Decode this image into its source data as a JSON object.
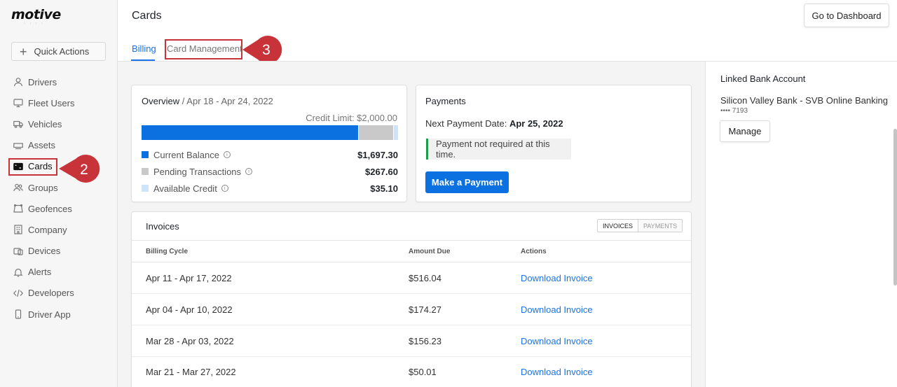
{
  "app": {
    "logo": "motive"
  },
  "sidebar": {
    "quick_actions": "Quick Actions",
    "items": [
      {
        "label": "Drivers",
        "icon": "user-icon"
      },
      {
        "label": "Fleet Users",
        "icon": "monitor-icon"
      },
      {
        "label": "Vehicles",
        "icon": "truck-icon"
      },
      {
        "label": "Assets",
        "icon": "trailer-icon"
      },
      {
        "label": "Cards",
        "icon": "card-icon"
      },
      {
        "label": "Groups",
        "icon": "group-icon"
      },
      {
        "label": "Geofences",
        "icon": "geofence-icon"
      },
      {
        "label": "Company",
        "icon": "building-icon"
      },
      {
        "label": "Devices",
        "icon": "device-icon"
      },
      {
        "label": "Alerts",
        "icon": "bell-icon"
      },
      {
        "label": "Developers",
        "icon": "code-icon"
      },
      {
        "label": "Driver App",
        "icon": "phone-icon"
      }
    ],
    "active": "Cards"
  },
  "callouts": {
    "step2": "2",
    "step3": "3",
    "color": "#c8333a"
  },
  "header": {
    "title": "Cards",
    "goto_dashboard": "Go to Dashboard",
    "tabs": [
      {
        "label": "Billing",
        "active": true
      },
      {
        "label": "Card Management",
        "active": false
      }
    ]
  },
  "overview": {
    "title": "Overview",
    "date_range": " / Apr 18 - Apr 24, 2022",
    "credit_limit": "Credit Limit: $2,000.00",
    "bar_fractions": {
      "current": 0.8487,
      "pending": 0.1338,
      "available": 0.0176
    },
    "legend": [
      {
        "label": "Current Balance",
        "value": "$1,697.30",
        "color": "#0b70e0"
      },
      {
        "label": "Pending Transactions",
        "value": "$267.60",
        "color": "#c9c9c9"
      },
      {
        "label": "Available Credit",
        "value": "$35.10",
        "color": "#cfe4f8"
      }
    ]
  },
  "payments": {
    "title": "Payments",
    "next_label": "Next Payment Date: ",
    "next_date": "Apr 25, 2022",
    "notice": "Payment not required at this time.",
    "make_payment": "Make a Payment"
  },
  "invoices": {
    "title": "Invoices",
    "toggle": [
      "INVOICES",
      "PAYMENTS"
    ],
    "columns": [
      "Billing Cycle",
      "Amount Due",
      "Actions"
    ],
    "rows": [
      {
        "cycle": "Apr 11 - Apr 17, 2022",
        "amount": "$516.04",
        "action": "Download Invoice"
      },
      {
        "cycle": "Apr 04 - Apr 10, 2022",
        "amount": "$174.27",
        "action": "Download Invoice"
      },
      {
        "cycle": "Mar 28 - Apr 03, 2022",
        "amount": "$156.23",
        "action": "Download Invoice"
      },
      {
        "cycle": "Mar 21 - Mar 27, 2022",
        "amount": "$50.01",
        "action": "Download Invoice"
      }
    ]
  },
  "bank": {
    "title": "Linked Bank Account",
    "name": "Silicon Valley Bank - SVB Online Banking",
    "mask": "•••• 7193",
    "manage": "Manage"
  }
}
